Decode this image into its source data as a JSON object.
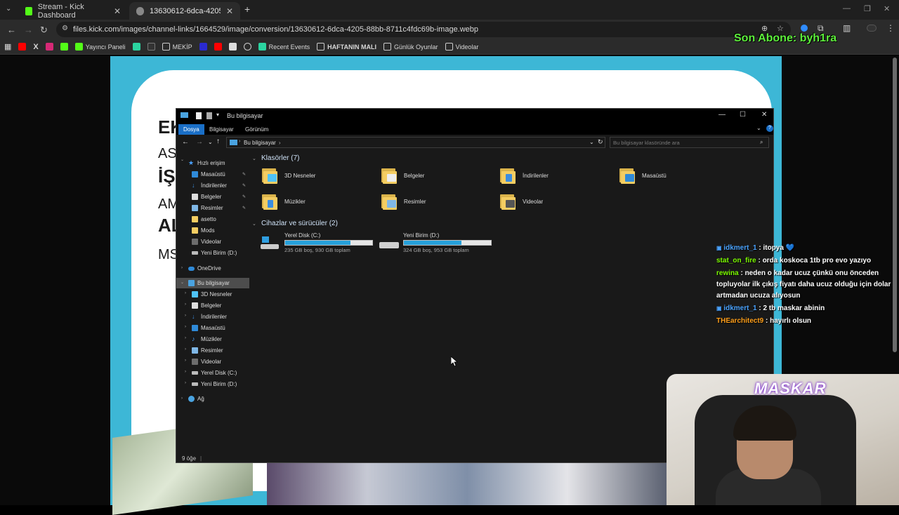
{
  "browser": {
    "tabs": [
      {
        "label": "Stream - Kick Dashboard"
      },
      {
        "label": "13630612-6dca-4205-88bb-87..."
      }
    ],
    "new_tab": "+",
    "url": "files.kick.com/images/channel-links/1664529/image/conversion/13630612-6dca-4205-88bb-8711c4fdc69b-image.webp",
    "bookmarks": {
      "yayinci": "Yayıncı Paneli",
      "mekip": "MEKİP",
      "recent": "Recent Events",
      "haftanin": "HAFTANIN MALI",
      "gunluk": "Günlük Oyunlar",
      "videolar": "Videolar"
    }
  },
  "banner": {
    "lines": [
      "EK",
      "AS",
      "İŞ",
      "AM",
      "AL",
      "MS"
    ]
  },
  "explorer": {
    "title": "Bu bilgisayar",
    "ribbon": {
      "dosya": "Dosya",
      "bilgisayar": "Bilgisayar",
      "gorunum": "Görünüm"
    },
    "address": "Bu bilgisayar",
    "search_placeholder": "Bu bilgisayar klasöründe ara",
    "nav": {
      "hizli": "Hızlı erişim",
      "masaustu": "Masaüstü",
      "indirilenler": "İndirilenler",
      "belgeler": "Belgeler",
      "resimler": "Resimler",
      "asetto": "asetto",
      "mods": "Mods",
      "videolar": "Videolar",
      "yeni_birim": "Yeni Birim (D:)",
      "onedrive": "OneDrive",
      "bu_bilgisayar": "Bu bilgisayar",
      "nesneler": "3D Nesneler",
      "muzikler": "Müzikler",
      "yerel_disk": "Yerel Disk (C:)",
      "ag": "Ağ"
    },
    "folders_header": "Klasörler (7)",
    "folders": {
      "nesneler": "3D Nesneler",
      "belgeler": "Belgeler",
      "indirilenler": "İndirilenler",
      "masaustu": "Masaüstü",
      "muzikler": "Müzikler",
      "resimler": "Resimler",
      "videolar": "Videolar"
    },
    "drives_header": "Cihazlar ve sürücüler (2)",
    "drives": [
      {
        "name": "Yerel Disk (C:)",
        "free_text": "235 GB boş, 930 GB toplam",
        "used_fraction": 0.75
      },
      {
        "name": "Yeni Birim (D:)",
        "free_text": "324 GB boş, 953 GB toplam",
        "used_fraction": 0.66
      }
    ],
    "status": "9 öğe"
  },
  "overlay": {
    "son_abone": "Son Abone: byh1ra",
    "cam_logo": "MASKAR",
    "chat": [
      {
        "user": "idkmert_1",
        "text": " : itopya 💙",
        "color": "#4aa3ff"
      },
      {
        "user": "stat_on_fire",
        "text": " : orda koskoca 1tb pro evo yazıyo",
        "color": "#7cfc00"
      },
      {
        "user": "rewina",
        "text": " : neden o kadar ucuz çünkü onu önceden topluyolar ilk çıkış fiyatı daha ucuz olduğu için dolar artmadan ucuza alıyosun",
        "color": "#7cfc00"
      },
      {
        "user": "idkmert_1",
        "text": " : 2 tb maskar abinin",
        "color": "#4aa3ff"
      },
      {
        "user": "THEarchitect9",
        "text": " : hayırlı olsun",
        "color": "#ff9f1a"
      }
    ]
  }
}
